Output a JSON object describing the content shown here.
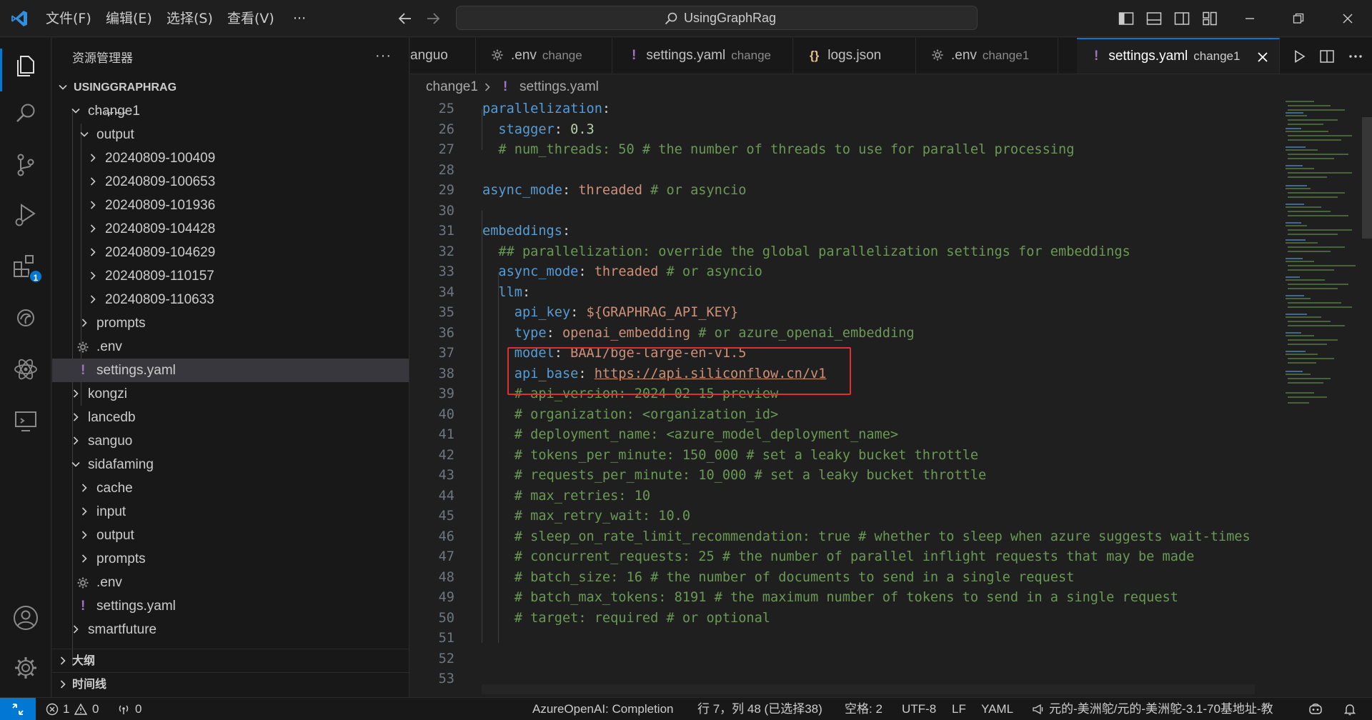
{
  "titlebar": {
    "menu": [
      "文件(F)",
      "编辑(E)",
      "选择(S)",
      "查看(V)",
      "···"
    ],
    "search": "UsingGraphRag"
  },
  "activity": {
    "extensions_badge": "1"
  },
  "sidebar": {
    "title": "资源管理器",
    "more": "···",
    "root": "USINGGRAPHRAG",
    "folder_change1": "change1",
    "partial_input": "input",
    "output": "output",
    "runs": [
      "20240809-100409",
      "20240809-100653",
      "20240809-101936",
      "20240809-104428",
      "20240809-104629",
      "20240809-110157",
      "20240809-110633"
    ],
    "prompts": "prompts",
    "env": ".env",
    "settings": "settings.yaml",
    "kongzi": "kongzi",
    "lancedb": "lancedb",
    "sanguo": "sanguo",
    "sidafaming": "sidafaming",
    "sida_children": [
      "cache",
      "input",
      "output",
      "prompts"
    ],
    "sida_env": ".env",
    "sida_settings": "settings.yaml",
    "smartfuture": "smartfuture",
    "outline": "大纲",
    "timeline": "时间线"
  },
  "tabs": [
    {
      "name": "anguo",
      "desc": ""
    },
    {
      "name": ".env",
      "desc": "change"
    },
    {
      "name": "settings.yaml",
      "desc": "change"
    },
    {
      "name": "logs.json",
      "desc": ""
    },
    {
      "name": ".env",
      "desc": "change1"
    },
    {
      "name": "settings.yaml",
      "desc": "change1"
    }
  ],
  "tab_marks": {
    "bang": "!",
    "json": "{}"
  },
  "breadcrumb": {
    "folder": "change1",
    "file": "settings.yaml"
  },
  "editor": {
    "lines": [
      {
        "n": "25",
        "t": "parallelization:"
      },
      {
        "n": "26",
        "t": "  stagger: 0.3"
      },
      {
        "n": "27",
        "t": "  # num_threads: 50 # the number of threads to use for parallel processing"
      },
      {
        "n": "28",
        "t": ""
      },
      {
        "n": "29",
        "t": "async_mode: threaded # or asyncio"
      },
      {
        "n": "30",
        "t": ""
      },
      {
        "n": "31",
        "t": "embeddings:"
      },
      {
        "n": "32",
        "t": "  ## parallelization: override the global parallelization settings for embeddings"
      },
      {
        "n": "33",
        "t": "  async_mode: threaded # or asyncio"
      },
      {
        "n": "34",
        "t": "  llm:"
      },
      {
        "n": "35",
        "t": "    api_key: ${GRAPHRAG_API_KEY}"
      },
      {
        "n": "36",
        "t": "    type: openai_embedding # or azure_openai_embedding"
      },
      {
        "n": "37",
        "t": "    model: BAAI/bge-large-en-v1.5"
      },
      {
        "n": "38",
        "t": "    api_base: https://api.siliconflow.cn/v1"
      },
      {
        "n": "39",
        "t": "    # api_version: 2024-02-15-preview"
      },
      {
        "n": "40",
        "t": "    # organization: <organization_id>"
      },
      {
        "n": "41",
        "t": "    # deployment_name: <azure_model_deployment_name>"
      },
      {
        "n": "42",
        "t": "    # tokens_per_minute: 150_000 # set a leaky bucket throttle"
      },
      {
        "n": "43",
        "t": "    # requests_per_minute: 10_000 # set a leaky bucket throttle"
      },
      {
        "n": "44",
        "t": "    # max_retries: 10"
      },
      {
        "n": "45",
        "t": "    # max_retry_wait: 10.0"
      },
      {
        "n": "46",
        "t": "    # sleep_on_rate_limit_recommendation: true # whether to sleep when azure suggests wait-times"
      },
      {
        "n": "47",
        "t": "    # concurrent_requests: 25 # the number of parallel inflight requests that may be made"
      },
      {
        "n": "48",
        "t": "    # batch_size: 16 # the number of documents to send in a single request"
      },
      {
        "n": "49",
        "t": "    # batch_max_tokens: 8191 # the maximum number of tokens to send in a single request"
      },
      {
        "n": "50",
        "t": "    # target: required # or optional"
      },
      {
        "n": "51",
        "t": ""
      },
      {
        "n": "52",
        "t": ""
      },
      {
        "n": "53",
        "t": ""
      }
    ]
  },
  "statusbar": {
    "errors": "1",
    "warnings": "0",
    "ports": "0",
    "model": "AzureOpenAI: Completion",
    "position": "行 7，列 48 (已选择38)",
    "spaces": "空格: 2",
    "encoding": "UTF-8",
    "eol": "LF",
    "language": "YAML",
    "broadcast": "元的-美洲鸵/元的-美洲鸵-3.1-70基地址-教"
  },
  "colors": {
    "accent": "#0078d4",
    "highlight_box": "#e0312f",
    "yaml_key": "#569cd6",
    "yaml_value": "#ce9178",
    "comment": "#6a9955",
    "number": "#b5cea8"
  }
}
